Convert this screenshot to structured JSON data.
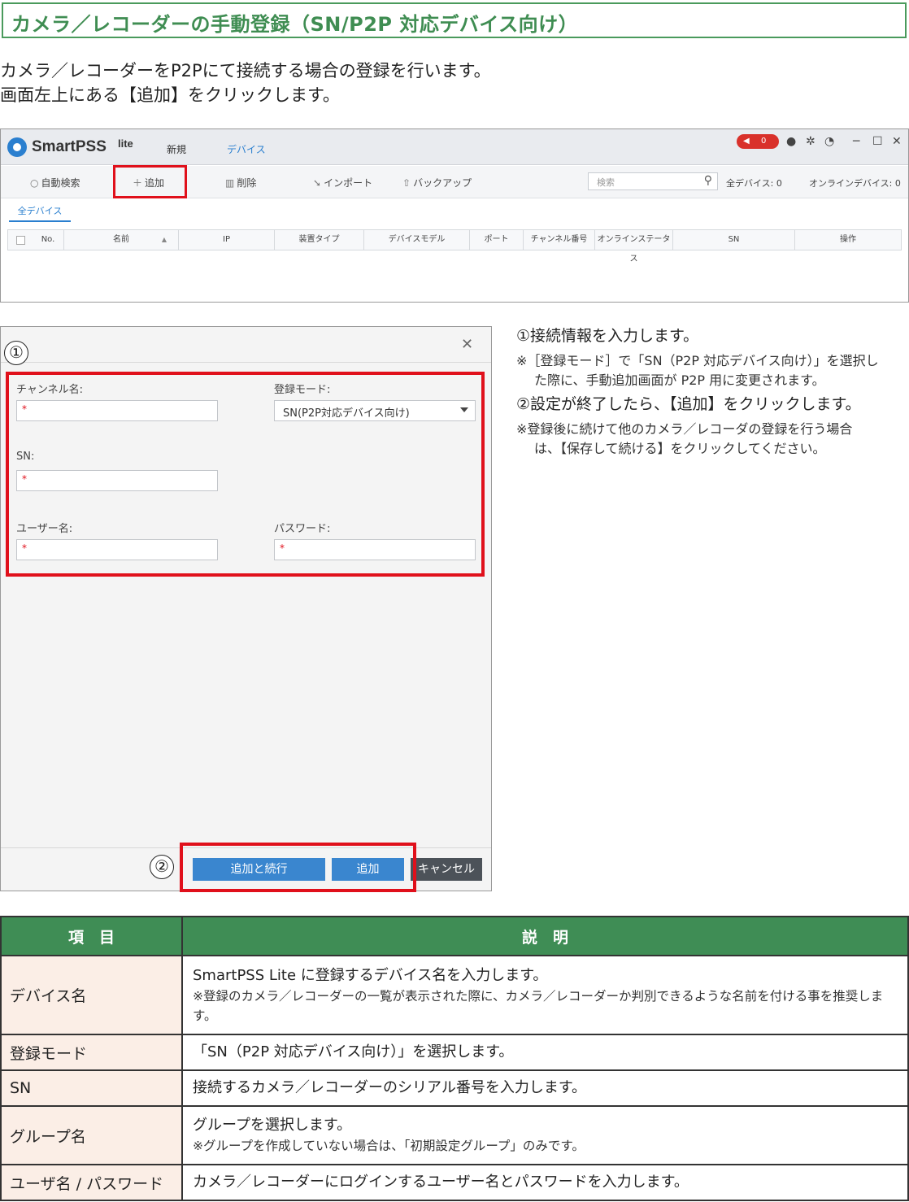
{
  "title": "カメラ／レコーダーの手動登録（SN/P2P 対応デバイス向け）",
  "intro": {
    "line1": "カメラ／レコーダーをP2Pにて接続する場合の登録を行います。",
    "line2": "画面左上にある【追加】をクリックします。"
  },
  "app": {
    "name": "SmartPSS",
    "name_suffix": "lite",
    "tabs": {
      "new": "新規",
      "device": "デバイス"
    },
    "alert_count": "0",
    "toolbar": {
      "auto_search": "自動検索",
      "add": "追加",
      "delete": "削除",
      "import": "インポート",
      "backup": "バックアップ",
      "search_placeholder": "検索",
      "all_devices": "全デバイス:",
      "all_devices_count": "0",
      "online_devices": "オンラインデバイス:",
      "online_devices_count": "0"
    },
    "subtab": "全デバイス",
    "columns": [
      "No.",
      "名前",
      "IP",
      "装置タイプ",
      "デバイスモデル",
      "ポート",
      "チャンネル番号",
      "オンラインステータス",
      "SN",
      "操作"
    ]
  },
  "dialog": {
    "marker1": "①",
    "marker2": "②",
    "fields": {
      "channel_label": "チャンネル名:",
      "mode_label": "登録モード:",
      "mode_value": "SN(P2P対応デバイス向け)",
      "sn_label": "SN:",
      "user_label": "ユーザー名:",
      "password_label": "パスワード:",
      "required_mark": "*"
    },
    "buttons": {
      "add_continue": "追加と続行",
      "add": "追加",
      "cancel": "キャンセル"
    }
  },
  "notes": {
    "n1": "①接続情報を入力します。",
    "n1_sub1": "※［登録モード］で「SN（P2P 対応デバイス向け）」を選択し",
    "n1_sub2": "た際に、手動追加画面が P2P 用に変更されます。",
    "n2": "②設定が終了したら、【追加】をクリックします。",
    "n2_sub1": "※登録後に続けて他のカメラ／レコーダの登録を行う場合",
    "n2_sub2": "は、【保存して続ける】をクリックしてください。"
  },
  "table": {
    "headers": {
      "item": "項　目",
      "desc": "説　明"
    },
    "rows": [
      {
        "item": "デバイス名",
        "desc": "SmartPSS Lite に登録するデバイス名を入力します。",
        "note": "※登録のカメラ／レコーダーの一覧が表示された際に、カメラ／レコーダーか判別できるような名前を付ける事を推奨します。"
      },
      {
        "item": "登録モード",
        "desc": "「SN（P2P 対応デバイス向け）」を選択します。"
      },
      {
        "item": "SN",
        "desc": "接続するカメラ／レコーダーのシリアル番号を入力します。"
      },
      {
        "item": "グループ名",
        "desc": "グループを選択します。",
        "note": "※グループを作成していない場合は、「初期設定グループ」のみです。"
      },
      {
        "item": "ユーザ名 / パスワード",
        "desc": "カメラ／レコーダーにログインするユーザー名とパスワードを入力します。"
      }
    ]
  }
}
